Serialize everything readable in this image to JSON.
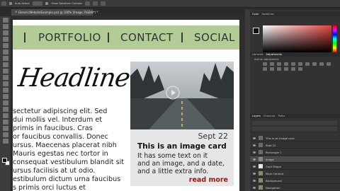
{
  "options_bar": {
    "auto_select": "Auto-Select:",
    "show_transform": "Show Transform Controls"
  },
  "document_tab": {
    "title": "GenericWebsiteExample.psd @ 100% (Image, RGB/8*) *"
  },
  "website": {
    "nav": {
      "items": [
        "PORTFOLIO",
        "CONTACT",
        "SOCIAL"
      ]
    },
    "headline": "Headline",
    "body_lines": [
      "sectetur adipiscing elit. Sed",
      "dui mollis vel. Interdum et",
      "primis in faucibus. Cras",
      "or faucibus convallis. Donec",
      "ursus. Maecenas placerat nibh",
      "Mauris egestas nec tortor in",
      "consequat vestibulum blandit sit",
      "ursus facilisis at ut odio."
    ],
    "body_lines_2": [
      "estibulum dictum urna faucibus",
      "s primis orci luctus et"
    ],
    "card": {
      "date": "Sept 22",
      "title": "This is an image card",
      "text_lines": [
        "It has some text on it",
        "and an image, and a date,",
        "and a little extra info."
      ],
      "link": "read more"
    }
  },
  "panels": {
    "color_tabs": [
      "Color",
      "Swatches"
    ],
    "adjust_tabs": [
      "Libraries",
      "Adjustments"
    ],
    "adjust_label": "Add an adjustment",
    "layers_tabs": [
      "Layers",
      "Channels",
      "Paths"
    ],
    "layers": [
      {
        "name": "This is an image card",
        "selected": false
      },
      {
        "name": "Sept 22",
        "selected": false
      },
      {
        "name": "Rectangle 1",
        "selected": false
      },
      {
        "name": "Image",
        "selected": true
      },
      {
        "name": "Card Shape",
        "selected": false
      },
      {
        "name": "Main Content",
        "selected": false
      },
      {
        "name": "Background",
        "selected": false
      },
      {
        "name": "Navigation",
        "selected": false
      }
    ]
  }
}
